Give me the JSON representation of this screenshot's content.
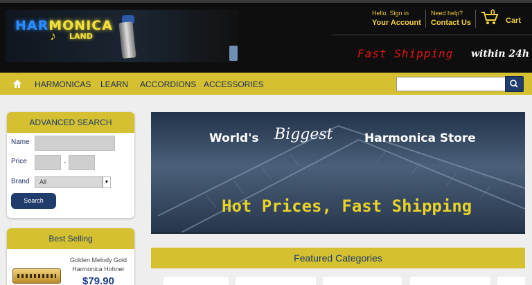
{
  "header": {
    "logo": {
      "line1_a": "HAR",
      "line1_b": "MONICA",
      "line2": "LAND"
    },
    "account": {
      "greeting": "Hello. Sign in",
      "label": "Your Account"
    },
    "help": {
      "greeting": "Need help?",
      "label": "Contact Us"
    },
    "cart": {
      "count": "0",
      "label": "Cart"
    },
    "shipping": {
      "text_red": "Fast Shipping",
      "text_white": "within 24h"
    }
  },
  "nav": {
    "items": [
      {
        "label": "HARMONICAS"
      },
      {
        "label": "LEARN"
      },
      {
        "label": "ACCORDIONS"
      },
      {
        "label": "ACCESSORIES"
      }
    ],
    "search": {
      "placeholder": ""
    }
  },
  "advanced_search": {
    "title": "ADVANCED SEARCH",
    "name_label": "Name",
    "price_label": "Price",
    "price_separator": "-",
    "brand_label": "Brand",
    "brand_value": "All",
    "button_label": "Search"
  },
  "best_selling": {
    "title": "Best Selling",
    "product": {
      "name": "Golden Melody Gold Harmonica Hohner",
      "price": "$79.90"
    }
  },
  "banner": {
    "line1_a": "World's",
    "line1_b": "Biggest",
    "line1_c": "Harmonica Store",
    "line2": "Hot Prices, Fast Shipping"
  },
  "featured": {
    "title": "Featured Categories"
  },
  "colors": {
    "accent": "#d4c030",
    "navy": "#1f3c6a",
    "header_bg": "#0e0e0e",
    "ship_red": "#e01414"
  }
}
